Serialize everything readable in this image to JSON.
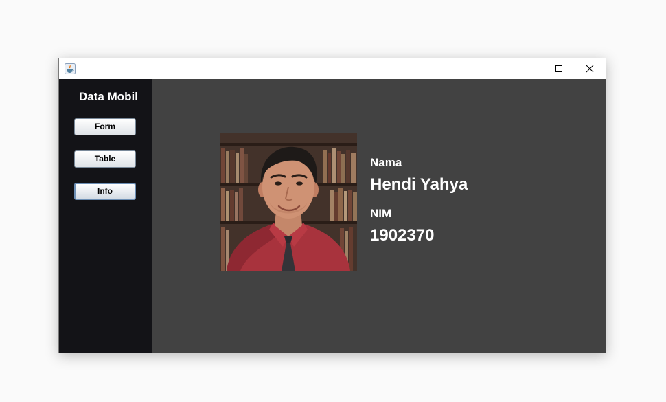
{
  "window": {
    "icon": "java-cup-icon",
    "controls": [
      "minimize-icon",
      "maximize-icon",
      "close-icon"
    ]
  },
  "sidebar": {
    "title": "Data Mobil",
    "buttons": [
      {
        "label": "Form"
      },
      {
        "label": "Table"
      },
      {
        "label": "Info",
        "active": true
      }
    ]
  },
  "profile": {
    "photo": "portrait-photo",
    "name_label": "Nama",
    "name_value": "Hendi Yahya",
    "nim_label": "NIM",
    "nim_value": "1902370"
  },
  "colors": {
    "sidebar_bg": "#131317",
    "content_bg": "#424242",
    "text": "#ffffff"
  }
}
